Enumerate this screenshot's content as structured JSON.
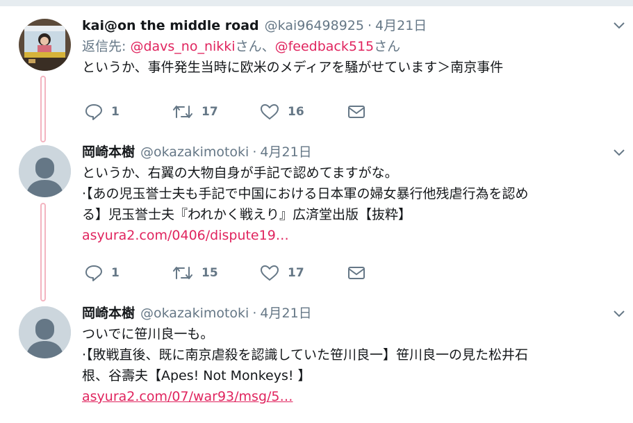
{
  "tweets": [
    {
      "name": "kai@on the middle road",
      "handle": "@kai96498925",
      "separator": "·",
      "time": "4月21日",
      "reply_prefix": "返信先: ",
      "reply_to_1": "@davs_no_nikki",
      "reply_mid": "さん、",
      "reply_to_2": "@feedback515",
      "reply_suffix": "さん",
      "text_lines": [
        "というか、事件発生当時に欧米のメディアを騒がせています＞南京事件"
      ],
      "replies": "1",
      "retweets": "17",
      "likes": "16"
    },
    {
      "name": "岡崎本樹",
      "handle": "@okazakimotoki",
      "separator": "·",
      "time": "4月21日",
      "text_lines": [
        "というか、右翼の大物自身が手記で認めてますがな。",
        "·【あの児玉誉士夫も手記で中国における日本軍の婦女暴行他残虐行為を認め",
        "る】児玉誉士夫『われかく戦えり』広済堂出版【抜粋】"
      ],
      "link": "asyura2.com/0406/dispute19…",
      "replies": "1",
      "retweets": "15",
      "likes": "17"
    },
    {
      "name": "岡崎本樹",
      "handle": "@okazakimotoki",
      "separator": "·",
      "time": "4月21日",
      "text_lines": [
        "ついでに笹川良一も。",
        "·【敗戦直後、既に南京虐殺を認識していた笹川良一】笹川良一の見た松井石",
        "根、谷壽夫【Apes! Not Monkeys! 】"
      ],
      "link": "asyura2.com/07/war93/msg/5…"
    }
  ],
  "icons": {
    "reply": "reply-icon",
    "retweet": "retweet-icon",
    "like": "heart-icon",
    "dm": "envelope-icon",
    "more": "chevron-down-icon"
  },
  "colors": {
    "accent_link": "#e0245e",
    "muted": "#657786",
    "thread_line": "#f3b4c0"
  }
}
